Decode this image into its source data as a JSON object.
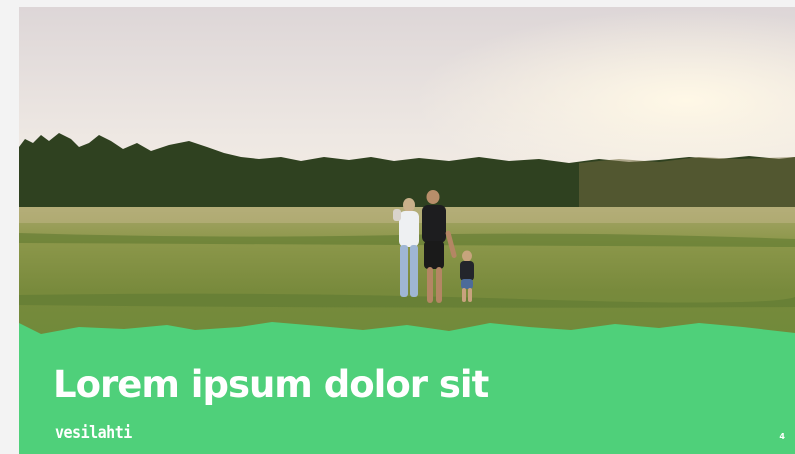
{
  "slide": {
    "title": "Lorem ipsum dolor sit",
    "logo_text": "vesilahti",
    "page_number": "4"
  },
  "colors": {
    "accent_green": "#4fd07a",
    "text": "#ffffff",
    "background": "#f3f3f3"
  },
  "image": {
    "subject": "family-in-field-photo"
  }
}
